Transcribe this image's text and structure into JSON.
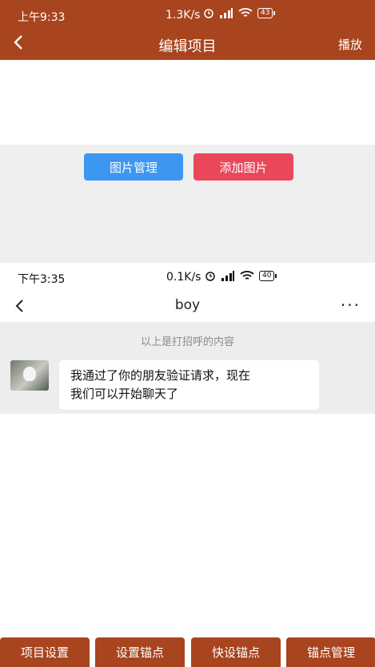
{
  "status_bar": {
    "time": "上午9:33",
    "speed": "1.3K/s",
    "battery": "43"
  },
  "appbar": {
    "title": "编辑项目",
    "play_label": "播放"
  },
  "editor": {
    "image_manage_label": "图片管理",
    "add_image_label": "添加图片"
  },
  "embedded_screenshot": {
    "status_time": "下午3:35",
    "status_speed": "0.1K/s",
    "status_battery": "40",
    "chat_title": "boy",
    "more": "···",
    "hint": "以上是打招呼的内容",
    "message_line1": "我通过了你的朋友验证请求，现在",
    "message_line2": "我们可以开始聊天了"
  },
  "bottom_bar": {
    "project_settings": "项目设置",
    "set_anchor": "设置锚点",
    "quick_anchor": "快设锚点",
    "anchor_manage": "锚点管理"
  },
  "colors": {
    "header": "#a8441e",
    "blue_button": "#3d97f0",
    "red_button": "#e8485a"
  }
}
